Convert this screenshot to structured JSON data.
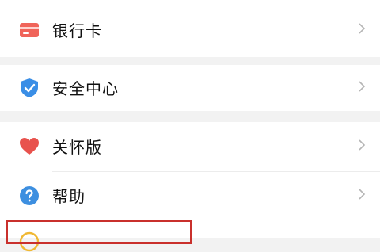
{
  "menu": {
    "items": [
      {
        "label": "银行卡",
        "icon": "bank-card-icon"
      },
      {
        "label": "安全中心",
        "icon": "shield-check-icon"
      },
      {
        "label": "关怀版",
        "icon": "heart-icon"
      },
      {
        "label": "帮助",
        "icon": "help-question-icon"
      }
    ]
  },
  "colors": {
    "card_red": "#f0645a",
    "shield_blue": "#3a8ee6",
    "heart_red": "#e8524d",
    "help_blue": "#3d8fe0",
    "highlight_red": "#c9302c",
    "coin_yellow": "#f0b833"
  }
}
